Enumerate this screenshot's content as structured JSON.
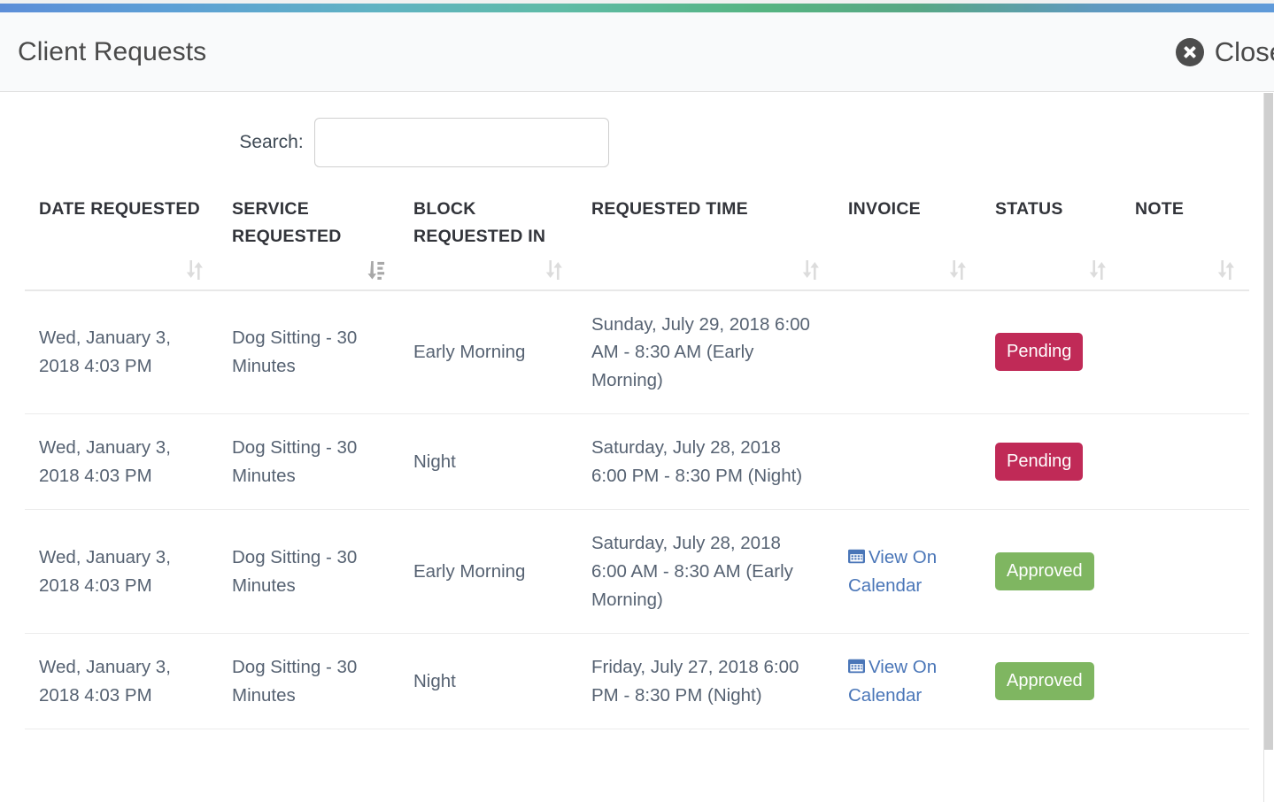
{
  "header": {
    "title": "Client Requests",
    "close_label": "Close",
    "close_icon": "close-circle-icon"
  },
  "theme": {
    "gradient_start": "#5d8ed8",
    "gradient_mid": "#5fbba6",
    "gradient_end": "#5f9ada",
    "header_bg": "#f9fafb",
    "text": "#566272",
    "heading": "#32343a",
    "link": "#4a76b8",
    "badge_pending": "#c02a57",
    "badge_approved": "#7fb661"
  },
  "search": {
    "label": "Search:",
    "value": "",
    "placeholder": ""
  },
  "table": {
    "columns": [
      {
        "label": "DATE REQUESTED",
        "sort": "none",
        "sort_icon": "sort-updown-icon"
      },
      {
        "label": "SERVICE REQUESTED",
        "sort": "desc",
        "sort_icon": "sort-amount-down-icon"
      },
      {
        "label": "BLOCK REQUESTED IN",
        "sort": "none",
        "sort_icon": "sort-updown-icon"
      },
      {
        "label": "REQUESTED TIME",
        "sort": "none",
        "sort_icon": "sort-updown-icon"
      },
      {
        "label": "INVOICE",
        "sort": "none",
        "sort_icon": "sort-updown-icon"
      },
      {
        "label": "STATUS",
        "sort": "none",
        "sort_icon": "sort-updown-icon"
      },
      {
        "label": "NOTE",
        "sort": "none",
        "sort_icon": "sort-updown-icon"
      }
    ],
    "rows": [
      {
        "date_requested": "Wed, January 3, 2018 4:03 PM",
        "service_requested": "Dog Sitting - 30 Minutes",
        "block_requested_in": "Early Morning",
        "requested_time": "Sunday, July 29, 2018 6:00 AM - 8:30 AM (Early Morning)",
        "invoice_label": "",
        "invoice_icon": "",
        "status": "Pending",
        "status_kind": "pending",
        "note": ""
      },
      {
        "date_requested": "Wed, January 3, 2018 4:03 PM",
        "service_requested": "Dog Sitting - 30 Minutes",
        "block_requested_in": "Night",
        "requested_time": "Saturday, July 28, 2018 6:00 PM - 8:30 PM (Night)",
        "invoice_label": "",
        "invoice_icon": "",
        "status": "Pending",
        "status_kind": "pending",
        "note": ""
      },
      {
        "date_requested": "Wed, January 3, 2018 4:03 PM",
        "service_requested": "Dog Sitting - 30 Minutes",
        "block_requested_in": "Early Morning",
        "requested_time": "Saturday, July 28, 2018 6:00 AM - 8:30 AM (Early Morning)",
        "invoice_label": "View On Calendar",
        "invoice_icon": "calendar-icon",
        "status": "Approved",
        "status_kind": "approved",
        "note": ""
      },
      {
        "date_requested": "Wed, January 3, 2018 4:03 PM",
        "service_requested": "Dog Sitting - 30 Minutes",
        "block_requested_in": "Night",
        "requested_time": "Friday, July 27, 2018 6:00 PM - 8:30 PM (Night)",
        "invoice_label": "View On Calendar",
        "invoice_icon": "calendar-icon",
        "status": "Approved",
        "status_kind": "approved",
        "note": ""
      }
    ]
  }
}
